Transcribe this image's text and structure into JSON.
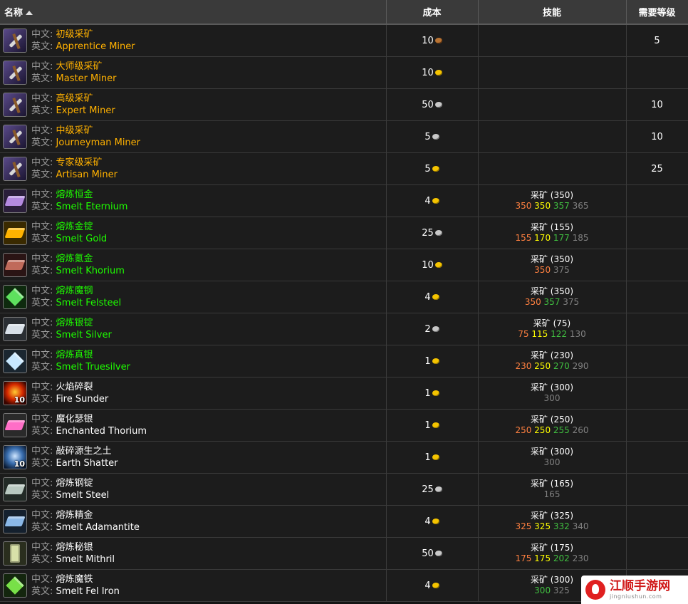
{
  "header": {
    "name": "名称",
    "cost": "成本",
    "skill": "技能",
    "level": "需要等级"
  },
  "labels": {
    "cn": "中文:",
    "en": "英文:"
  },
  "rows": [
    {
      "icon": "pickaxe-icon",
      "cn": "初级采矿",
      "en": "Apprentice Miner",
      "cost": "10",
      "coin": "copper",
      "level": "5",
      "color": "orange"
    },
    {
      "icon": "pickaxe-icon",
      "cn": "大师级采矿",
      "en": "Master Miner",
      "cost": "10",
      "coin": "gold",
      "level": "",
      "color": "orange"
    },
    {
      "icon": "pickaxe-icon",
      "cn": "高级采矿",
      "en": "Expert Miner",
      "cost": "50",
      "coin": "silver",
      "level": "10",
      "color": "orange"
    },
    {
      "icon": "pickaxe-icon",
      "cn": "中级采矿",
      "en": "Journeyman Miner",
      "cost": "5",
      "coin": "silver",
      "level": "10",
      "color": "orange"
    },
    {
      "icon": "pickaxe-icon",
      "cn": "专家级采矿",
      "en": "Artisan Miner",
      "cost": "5",
      "coin": "gold",
      "level": "25",
      "color": "orange"
    },
    {
      "icon": "eternium-bar-icon",
      "cn": "熔炼恒金",
      "en": "Smelt Eternium",
      "cost": "4",
      "coin": "gold",
      "color": "green",
      "skill": {
        "name": "采矿",
        "req": "(350)",
        "ranks": [
          "350",
          "350",
          "357",
          "365"
        ]
      }
    },
    {
      "icon": "gold-bar-icon",
      "cn": "熔炼金锭",
      "en": "Smelt Gold",
      "cost": "25",
      "coin": "silver",
      "color": "green",
      "skill": {
        "name": "采矿",
        "req": "(155)",
        "ranks": [
          "155",
          "170",
          "177",
          "185"
        ]
      }
    },
    {
      "icon": "khorium-bar-icon",
      "cn": "熔炼氪金",
      "en": "Smelt Khorium",
      "cost": "10",
      "coin": "gold",
      "color": "green",
      "skill": {
        "name": "采矿",
        "req": "(350)",
        "ranks": [
          "350",
          "",
          "",
          "375"
        ]
      }
    },
    {
      "icon": "felsteel-bar-icon",
      "cn": "熔炼魔钢",
      "en": "Smelt Felsteel",
      "cost": "4",
      "coin": "gold",
      "color": "green",
      "skill": {
        "name": "采矿",
        "req": "(350)",
        "ranks": [
          "350",
          "",
          "357",
          "375"
        ]
      }
    },
    {
      "icon": "silver-bar-icon",
      "cn": "熔炼银锭",
      "en": "Smelt Silver",
      "cost": "2",
      "coin": "silver",
      "color": "green",
      "skill": {
        "name": "采矿",
        "req": "(75)",
        "ranks": [
          "75",
          "115",
          "122",
          "130"
        ]
      }
    },
    {
      "icon": "truesilver-bar-icon",
      "cn": "熔炼真银",
      "en": "Smelt Truesilver",
      "cost": "1",
      "coin": "gold",
      "color": "green",
      "skill": {
        "name": "采矿",
        "req": "(230)",
        "ranks": [
          "230",
          "250",
          "270",
          "290"
        ]
      }
    },
    {
      "icon": "fire-sunder-icon",
      "badge": "10",
      "cn": "火焰碎裂",
      "en": "Fire Sunder",
      "cost": "1",
      "coin": "gold",
      "color": "white",
      "skill": {
        "name": "采矿",
        "req": "(300)",
        "ranks": [
          "",
          "",
          "",
          "300"
        ]
      }
    },
    {
      "icon": "enchanted-thorium-icon",
      "cn": "魔化瑟银",
      "en": "Enchanted Thorium",
      "cost": "1",
      "coin": "gold",
      "color": "white",
      "skill": {
        "name": "采矿",
        "req": "(250)",
        "ranks": [
          "250",
          "250",
          "255",
          "260"
        ]
      }
    },
    {
      "icon": "earth-shatter-icon",
      "badge": "10",
      "cn": "敲碎源生之土",
      "en": "Earth Shatter",
      "cost": "1",
      "coin": "gold",
      "color": "white",
      "skill": {
        "name": "采矿",
        "req": "(300)",
        "ranks": [
          "",
          "",
          "",
          "300"
        ]
      }
    },
    {
      "icon": "steel-bar-icon",
      "cn": "熔炼钢锭",
      "en": "Smelt Steel",
      "cost": "25",
      "coin": "silver",
      "color": "white",
      "skill": {
        "name": "采矿",
        "req": "(165)",
        "ranks": [
          "",
          "",
          "",
          "165"
        ]
      }
    },
    {
      "icon": "adamantite-bar-icon",
      "cn": "熔炼精金",
      "en": "Smelt Adamantite",
      "cost": "4",
      "coin": "gold",
      "color": "white",
      "skill": {
        "name": "采矿",
        "req": "(325)",
        "ranks": [
          "325",
          "325",
          "332",
          "340"
        ]
      }
    },
    {
      "icon": "mithril-bar-icon",
      "cn": "熔炼秘银",
      "en": "Smelt Mithril",
      "cost": "50",
      "coin": "silver",
      "color": "white",
      "skill": {
        "name": "采矿",
        "req": "(175)",
        "ranks": [
          "175",
          "175",
          "202",
          "230"
        ]
      }
    },
    {
      "icon": "fel-iron-bar-icon",
      "cn": "熔炼魔铁",
      "en": "Smelt Fel Iron",
      "cost": "4",
      "coin": "gold",
      "color": "white",
      "skill": {
        "name": "采矿",
        "req": "(300)",
        "ranks": [
          "",
          "",
          "300",
          "325"
        ]
      }
    }
  ],
  "iconStyles": {
    "pickaxe-icon": {
      "cls": "pick"
    },
    "eternium-bar-icon": {
      "cls": "bar",
      "bg": "#2a1e3a",
      "bar": "#b48ae0"
    },
    "gold-bar-icon": {
      "cls": "bar",
      "bg": "#3a2a00",
      "bar": "#ffb300"
    },
    "khorium-bar-icon": {
      "cls": "bar",
      "bg": "#2a1414",
      "bar": "#c06a5a"
    },
    "felsteel-bar-icon": {
      "cls": "crystal",
      "bg": "#0e2a0e",
      "bar": "#5ee05e"
    },
    "silver-bar-icon": {
      "cls": "bar",
      "bg": "#2a2e33",
      "bar": "#d8e0e8"
    },
    "truesilver-bar-icon": {
      "cls": "crystal",
      "bg": "#1a2630",
      "bar": "#c8e8ff"
    },
    "fire-sunder-icon": {
      "cls": "fire"
    },
    "enchanted-thorium-icon": {
      "cls": "bar",
      "bg": "#2a2a2a",
      "bar": "#ff6ec7"
    },
    "earth-shatter-icon": {
      "cls": "earth"
    },
    "steel-bar-icon": {
      "cls": "bar",
      "bg": "#222a26",
      "bar": "#b8c8c0"
    },
    "adamantite-bar-icon": {
      "cls": "bar",
      "bg": "#14202e",
      "bar": "#8ab8e8"
    },
    "mithril-bar-icon": {
      "cls": "tile",
      "bg": "#2a2e1e",
      "bar": "#d8e0a8"
    },
    "fel-iron-bar-icon": {
      "cls": "crystal",
      "bg": "#14260e",
      "bar": "#78e048"
    }
  },
  "watermark": {
    "title": "江顺手游网",
    "sub": "jingniushun.com"
  }
}
